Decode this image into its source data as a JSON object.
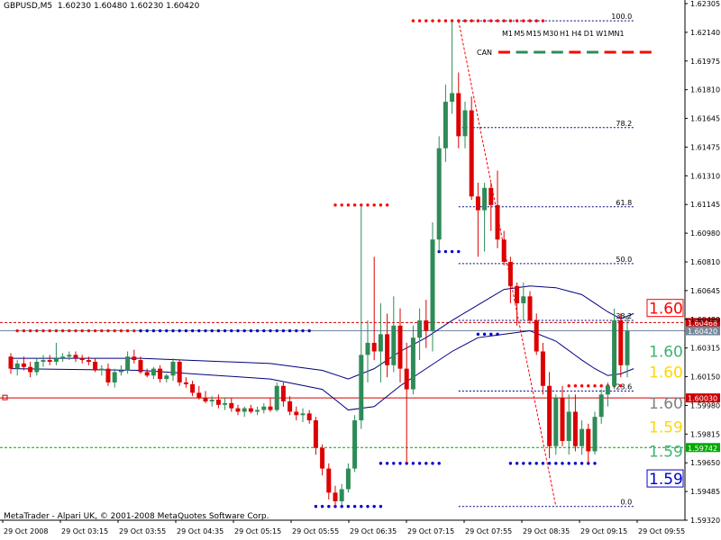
{
  "header": {
    "symbol": "GBPUSD,M5",
    "ohlc": "1.60230 1.60480 1.60230 1.60420"
  },
  "footer": {
    "copyright": "MetaTrader - Alpari UK, © 2001-2008 MetaQuotes Software Corp."
  },
  "timeframes": [
    "M1",
    "M5",
    "M15",
    "M30",
    "H1",
    "H4",
    "D1",
    "W1",
    "MN1"
  ],
  "can": {
    "label": "CAN",
    "colors": [
      "#ff0000",
      "#2e8b57",
      "#2e8b57",
      "#2e8b57",
      "#ff0000",
      "#2e8b57",
      "#ff0000",
      "#ff0000",
      "#ff0000"
    ]
  },
  "chart_data": {
    "type": "candlestick",
    "ylim": [
      1.5932,
      1.6232
    ],
    "y_ticks": [
      "1.62305",
      "1.62140",
      "1.61975",
      "1.61810",
      "1.61645",
      "1.61475",
      "1.61310",
      "1.61145",
      "1.60980",
      "1.60810",
      "1.60645",
      "1.60480",
      "1.60315",
      "1.60150",
      "1.59980",
      "1.59815",
      "1.59650",
      "1.59485",
      "1.59320"
    ],
    "x_ticks": [
      "29 Oct 2008",
      "29 Oct 03:15",
      "29 Oct 03:55",
      "29 Oct 04:35",
      "29 Oct 05:15",
      "29 Oct 05:55",
      "29 Oct 06:35",
      "29 Oct 07:15",
      "29 Oct 07:55",
      "29 Oct 08:35",
      "29 Oct 09:15",
      "29 Oct 09:55"
    ],
    "candles": [
      [
        1.6027,
        1.6029,
        1.6017,
        1.602
      ],
      [
        1.602,
        1.6025,
        1.6016,
        1.6023
      ],
      [
        1.6023,
        1.6027,
        1.6019,
        1.6021
      ],
      [
        1.6021,
        1.6024,
        1.6015,
        1.6018
      ],
      [
        1.6018,
        1.6026,
        1.6016,
        1.6024
      ],
      [
        1.6024,
        1.6028,
        1.6021,
        1.6025
      ],
      [
        1.6025,
        1.6028,
        1.6022,
        1.6024
      ],
      [
        1.6024,
        1.6035,
        1.6022,
        1.6026
      ],
      [
        1.6026,
        1.6029,
        1.6024,
        1.6027
      ],
      [
        1.6027,
        1.603,
        1.6025,
        1.6028
      ],
      [
        1.6028,
        1.603,
        1.6024,
        1.6026
      ],
      [
        1.6026,
        1.6028,
        1.6023,
        1.6025
      ],
      [
        1.6025,
        1.6027,
        1.6022,
        1.6024
      ],
      [
        1.6024,
        1.6026,
        1.6018,
        1.6019
      ],
      [
        1.6019,
        1.6022,
        1.6016,
        1.602
      ],
      [
        1.602,
        1.6023,
        1.601,
        1.6012
      ],
      [
        1.6012,
        1.602,
        1.6009,
        1.6018
      ],
      [
        1.6018,
        1.6022,
        1.6016,
        1.6019
      ],
      [
        1.6019,
        1.603,
        1.6017,
        1.6027
      ],
      [
        1.6027,
        1.6031,
        1.6023,
        1.6025
      ],
      [
        1.6025,
        1.6027,
        1.6017,
        1.6018
      ],
      [
        1.6018,
        1.602,
        1.6015,
        1.6016
      ],
      [
        1.6016,
        1.6021,
        1.6014,
        1.602
      ],
      [
        1.602,
        1.6022,
        1.6012,
        1.6014
      ],
      [
        1.6014,
        1.6017,
        1.6012,
        1.6016
      ],
      [
        1.6016,
        1.6026,
        1.6013,
        1.6024
      ],
      [
        1.6024,
        1.6025,
        1.601,
        1.6012
      ],
      [
        1.6012,
        1.6015,
        1.6009,
        1.6011
      ],
      [
        1.6011,
        1.6013,
        1.6004,
        1.6006
      ],
      [
        1.6006,
        1.601,
        1.6002,
        1.6003
      ],
      [
        1.6003,
        1.6007,
        1.6,
        1.6001
      ],
      [
        1.6001,
        1.6004,
        1.5998,
        1.6002
      ],
      [
        1.6002,
        1.6005,
        1.5997,
        1.5999
      ],
      [
        1.5999,
        1.6003,
        1.5996,
        1.6
      ],
      [
        1.6,
        1.6003,
        1.5995,
        1.5997
      ],
      [
        1.5997,
        1.5999,
        1.5993,
        1.5995
      ],
      [
        1.5995,
        1.5998,
        1.5992,
        1.5997
      ],
      [
        1.5997,
        1.5999,
        1.5994,
        1.5995
      ],
      [
        1.5995,
        1.5998,
        1.5993,
        1.5996
      ],
      [
        1.5996,
        1.6,
        1.5994,
        1.5998
      ],
      [
        1.5998,
        1.6003,
        1.5995,
        1.5996
      ],
      [
        1.5996,
        1.6012,
        1.5995,
        1.601
      ],
      [
        1.601,
        1.6012,
        1.5998,
        1.6001
      ],
      [
        1.6001,
        1.6004,
        1.5993,
        1.5995
      ],
      [
        1.5995,
        1.5998,
        1.599,
        1.5993
      ],
      [
        1.5993,
        1.5997,
        1.5989,
        1.5994
      ],
      [
        1.5994,
        1.5996,
        1.5988,
        1.599
      ],
      [
        1.599,
        1.5992,
        1.597,
        1.5974
      ],
      [
        1.5974,
        1.5976,
        1.5958,
        1.5962
      ],
      [
        1.5962,
        1.5965,
        1.5944,
        1.5948
      ],
      [
        1.5948,
        1.5952,
        1.594,
        1.5943
      ],
      [
        1.5943,
        1.5953,
        1.5941,
        1.595
      ],
      [
        1.595,
        1.5965,
        1.5948,
        1.5962
      ],
      [
        1.5962,
        1.5993,
        1.596,
        1.599
      ],
      [
        1.599,
        1.6115,
        1.5985,
        1.6028
      ],
      [
        1.6028,
        1.6048,
        1.6012,
        1.6035
      ],
      [
        1.6035,
        1.6085,
        1.6025,
        1.603
      ],
      [
        1.603,
        1.6058,
        1.6012,
        1.604
      ],
      [
        1.604,
        1.6052,
        1.6015,
        1.6022
      ],
      [
        1.6022,
        1.6062,
        1.6018,
        1.6045
      ],
      [
        1.6045,
        1.6055,
        1.6012,
        1.602
      ],
      [
        1.602,
        1.6035,
        1.5965,
        1.6008
      ],
      [
        1.6008,
        1.6045,
        1.6005,
        1.6038
      ],
      [
        1.6038,
        1.6055,
        1.6025,
        1.6048
      ],
      [
        1.6048,
        1.606,
        1.6032,
        1.6042
      ],
      [
        1.6042,
        1.6105,
        1.603,
        1.6095
      ],
      [
        1.6095,
        1.6155,
        1.6088,
        1.6148
      ],
      [
        1.6148,
        1.6185,
        1.614,
        1.6175
      ],
      [
        1.6175,
        1.6222,
        1.6168,
        1.618
      ],
      [
        1.618,
        1.6192,
        1.6148,
        1.6155
      ],
      [
        1.6155,
        1.6175,
        1.6148,
        1.617
      ],
      [
        1.617,
        1.6178,
        1.6118,
        1.612
      ],
      [
        1.612,
        1.6128,
        1.6085,
        1.6112
      ],
      [
        1.6112,
        1.6128,
        1.6088,
        1.6125
      ],
      [
        1.6125,
        1.6128,
        1.61,
        1.6115
      ],
      [
        1.6115,
        1.6135,
        1.609,
        1.6095
      ],
      [
        1.6095,
        1.61,
        1.608,
        1.6082
      ],
      [
        1.6082,
        1.6085,
        1.6058,
        1.6068
      ],
      [
        1.6068,
        1.607,
        1.6045,
        1.6058
      ],
      [
        1.6058,
        1.607,
        1.6048,
        1.6062
      ],
      [
        1.6062,
        1.6065,
        1.6046,
        1.6048
      ],
      [
        1.6048,
        1.6052,
        1.6028,
        1.603
      ],
      [
        1.603,
        1.6035,
        1.6005,
        1.601
      ],
      [
        1.601,
        1.6018,
        1.5968,
        1.5975
      ],
      [
        1.5975,
        1.6005,
        1.597,
        1.6003
      ],
      [
        1.6003,
        1.601,
        1.5975,
        1.5978
      ],
      [
        1.5978,
        1.6005,
        1.597,
        1.5995
      ],
      [
        1.5995,
        1.6005,
        1.5972,
        1.5975
      ],
      [
        1.5975,
        1.599,
        1.597,
        1.5985
      ],
      [
        1.5985,
        1.5988,
        1.5965,
        1.5972
      ],
      [
        1.5972,
        1.5995,
        1.597,
        1.5992
      ],
      [
        1.5992,
        1.6008,
        1.5988,
        1.6005
      ],
      [
        1.6005,
        1.6012,
        1.5998,
        1.601
      ],
      [
        1.601,
        1.6055,
        1.6008,
        1.6048
      ],
      [
        1.6048,
        1.6052,
        1.6015,
        1.6022
      ],
      [
        1.6022,
        1.605,
        1.6015,
        1.6042
      ]
    ],
    "ma_upper": [
      [
        0,
        1.6026
      ],
      [
        20,
        1.6026
      ],
      [
        40,
        1.6023
      ],
      [
        48,
        1.6019
      ],
      [
        52,
        1.6014
      ],
      [
        56,
        1.602
      ],
      [
        60,
        1.603
      ],
      [
        64,
        1.6038
      ],
      [
        68,
        1.6048
      ],
      [
        72,
        1.6057
      ],
      [
        76,
        1.6066
      ],
      [
        80,
        1.6068
      ],
      [
        84,
        1.6067
      ],
      [
        88,
        1.6063
      ],
      [
        90,
        1.6058
      ],
      [
        92,
        1.6053
      ],
      [
        94,
        1.6049
      ],
      [
        96,
        1.6052
      ]
    ],
    "ma_lower": [
      [
        0,
        1.602
      ],
      [
        20,
        1.6019
      ],
      [
        40,
        1.6014
      ],
      [
        48,
        1.6008
      ],
      [
        52,
        1.5996
      ],
      [
        56,
        1.5998
      ],
      [
        60,
        1.601
      ],
      [
        64,
        1.602
      ],
      [
        68,
        1.603
      ],
      [
        72,
        1.6038
      ],
      [
        76,
        1.604
      ],
      [
        80,
        1.6042
      ],
      [
        84,
        1.6036
      ],
      [
        88,
        1.6025
      ],
      [
        90,
        1.602
      ],
      [
        92,
        1.6016
      ],
      [
        94,
        1.6017
      ],
      [
        96,
        1.602
      ]
    ],
    "fibo_levels": [
      {
        "label": "100.0",
        "price": 1.6222
      },
      {
        "label": "78.2",
        "price": 1.616
      },
      {
        "label": "61.8",
        "price": 1.6114
      },
      {
        "label": "50.0",
        "price": 1.6081
      },
      {
        "label": "38.2",
        "price": 1.6048
      },
      {
        "label": "23.6",
        "price": 1.6007
      },
      {
        "label": "0.0",
        "price": 1.594
      }
    ],
    "support_resistance": [
      {
        "price": 1.6115,
        "from": 50,
        "to": 58,
        "color": "#ff0000"
      },
      {
        "price": 1.5965,
        "from": 57,
        "to": 66,
        "color": "#0000cc"
      },
      {
        "price": 1.6222,
        "from": 62,
        "to": 82,
        "color": "#ff0000"
      },
      {
        "price": 1.6088,
        "from": 66,
        "to": 69,
        "color": "#0000cc"
      },
      {
        "price": 1.604,
        "from": 72,
        "to": 75,
        "color": "#0000cc"
      },
      {
        "price": 1.594,
        "from": 47,
        "to": 57,
        "color": "#0000cc"
      },
      {
        "price": 1.5965,
        "from": 77,
        "to": 90,
        "color": "#0000cc"
      },
      {
        "price": 1.601,
        "from": 86,
        "to": 94,
        "color": "#ff0000"
      },
      {
        "price": 1.6042,
        "from": 1,
        "to": 20,
        "color": "#ff0000"
      },
      {
        "price": 1.6042,
        "from": 20,
        "to": 46,
        "color": "#0000cc"
      }
    ],
    "horizontal_lines": [
      {
        "price": 1.60468,
        "label": "1.60468",
        "color": "#cc0000",
        "dash": "3,2"
      },
      {
        "price": 1.6042,
        "label": "1.60420",
        "color": "#778899",
        "dash": ""
      },
      {
        "price": 1.6003,
        "label": "1.60030",
        "color": "#cc0000",
        "dash": ""
      },
      {
        "price": 1.59742,
        "label": "1.59742",
        "color": "#00aa00",
        "dash": "3,2"
      }
    ],
    "pivot_labels": [
      {
        "text": "1.60",
        "price": 1.6055,
        "color": "#ff0000",
        "border": "#ff0000"
      },
      {
        "text": "1.60",
        "price": 1.603,
        "color": "#3cb371",
        "border": ""
      },
      {
        "text": "1.60",
        "price": 1.6018,
        "color": "#ffd700",
        "border": ""
      },
      {
        "text": "1.60",
        "price": 1.6,
        "color": "#808080",
        "border": ""
      },
      {
        "text": "1.59",
        "price": 1.5986,
        "color": "#ffd700",
        "border": ""
      },
      {
        "text": "1.59",
        "price": 1.5972,
        "color": "#3cb371",
        "border": ""
      },
      {
        "text": "1.59",
        "price": 1.5956,
        "color": "#0000cc",
        "border": "#0000cc"
      }
    ]
  }
}
